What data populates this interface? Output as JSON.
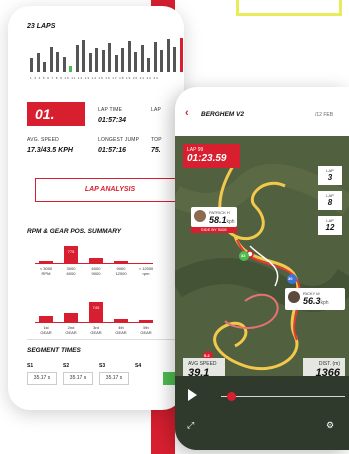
{
  "left_screen": {
    "laps_title": "23 LAPS",
    "bar_heights": [
      0.4,
      0.55,
      0.3,
      0.75,
      0.6,
      0.45,
      0.18,
      0.8,
      0.95,
      0.55,
      0.7,
      0.65,
      0.85,
      0.5,
      0.72,
      0.9,
      0.6,
      0.78,
      0.4,
      0.88,
      0.66,
      0.96,
      0.75,
      1.0
    ],
    "highlight_bar_index": 6,
    "red_bar_index": 23,
    "bar_axis_labels": "1 3 4 5 6 7 8 9 10 11 12 13 14 15 16 17 18 19 20 21 22 23",
    "lap_number": "01.",
    "lap_time_label": "LAP TIME",
    "lap_time_value": "01:57:34",
    "lap_col3_label": "LAP",
    "avg_speed_label": "AVG. SPEED",
    "avg_speed_value": "17.3/43.5 KPH",
    "longest_jump_label": "LONGEST JUMP",
    "longest_jump_value": "01:57:16",
    "top_label": "TOP",
    "top_value": "75.",
    "lap_analysis": "LAP ANALYSIS",
    "rpm_title": "RPM & GEAR POS. SUMMARY",
    "rpm_bars": [
      {
        "top": "",
        "label": "< 3000\nRPM",
        "height": 0.12
      },
      {
        "top": "775",
        "label": "3000\n6000",
        "height": 1.0
      },
      {
        "top": "",
        "label": "6000\n9000",
        "height": 0.3
      },
      {
        "top": "",
        "label": "9000\n12000",
        "height": 0.12
      },
      {
        "top": "",
        "label": "> 12000\nrpm",
        "height": 0.0
      }
    ],
    "gear_bars": [
      {
        "top": "",
        "label": "1st\nGEAR",
        "height": 0.3
      },
      {
        "top": "",
        "label": "2nd\nGEAR",
        "height": 0.45
      },
      {
        "top": "745",
        "label": "3rd\nGEAR",
        "height": 1.0
      },
      {
        "top": "",
        "label": "4th\nGEAR",
        "height": 0.15
      },
      {
        "top": "",
        "label": "5th\nGEAR",
        "height": 0.1
      }
    ],
    "segment_title": "SEGMENT TIMES",
    "segments": [
      {
        "name": "S1",
        "time": "35.17 s"
      },
      {
        "name": "S2",
        "time": "35.17 s"
      },
      {
        "name": "S3",
        "time": "35.17 s"
      },
      {
        "name": "S4",
        "time": ""
      }
    ]
  },
  "right_screen": {
    "title": "BERGHEM V2",
    "date": "/12 FEB",
    "lap_label": "LAP 99",
    "lap_time": "01:23.59",
    "side_cards": [
      {
        "label": "LAP",
        "value": "3"
      },
      {
        "label": "LAP",
        "value": "8"
      },
      {
        "label": "LAP",
        "value": "12"
      }
    ],
    "rider1": {
      "name": "PATRICK H",
      "speed": "58.1",
      "unit": "kph"
    },
    "side_by_side": "SIDE BY SIDE",
    "rider2": {
      "name": "RICKY M",
      "speed": "56.3",
      "unit": "kph"
    },
    "marker_30": "30",
    "marker_32": "32",
    "marker_52": "5.2",
    "avg_speed_label": "AVG SPEED",
    "avg_speed_value": "39.1",
    "dist_label": "DIST. (m)",
    "dist_value": "1366",
    "playback_progress": 0.05
  },
  "colors": {
    "accent_red": "#d71f30",
    "track_green": "#4dbb4f",
    "yellow": "#e6ec5a"
  }
}
